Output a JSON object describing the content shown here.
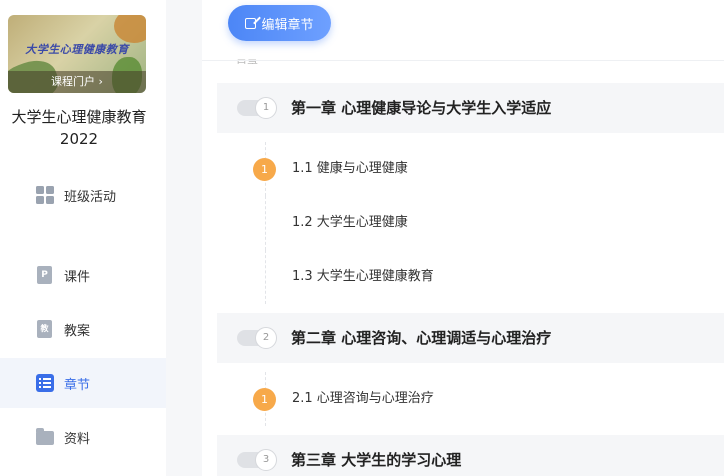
{
  "course": {
    "cover_title": "大学生心理健康教育",
    "portal_link": "课程门户 ›",
    "name": "大学生心理健康教育2022"
  },
  "nav": [
    {
      "label": "班级活动",
      "icon": "grid-icon",
      "active": false
    },
    {
      "label": "课件",
      "icon": "ppt-doc-icon",
      "active": false
    },
    {
      "label": "教案",
      "icon": "lesson-doc-icon",
      "active": false
    },
    {
      "label": "章节",
      "icon": "list-icon",
      "active": true
    },
    {
      "label": "资料",
      "icon": "folder-icon",
      "active": false
    }
  ],
  "icons": {
    "ppt_glyph": "P",
    "lesson_glyph": "教"
  },
  "toolbar": {
    "edit_label": "编辑章节"
  },
  "catalog_label": "目录",
  "chapters": [
    {
      "number": "1",
      "title": "第一章 心理健康导论与大学生入学适应",
      "sections": [
        {
          "badge": "1",
          "title": "1.1 健康与心理健康"
        },
        {
          "badge": "",
          "title": "1.2 大学生心理健康"
        },
        {
          "badge": "",
          "title": "1.3 大学生心理健康教育"
        }
      ]
    },
    {
      "number": "2",
      "title": "第二章 心理咨询、心理调适与心理治疗",
      "sections": [
        {
          "badge": "1",
          "title": "2.1 心理咨询与心理治疗"
        }
      ]
    },
    {
      "number": "3",
      "title": "第三章 大学生的学习心理",
      "sections": []
    }
  ],
  "colors": {
    "accent": "#3a6ee8",
    "badge": "#f7a94a"
  }
}
